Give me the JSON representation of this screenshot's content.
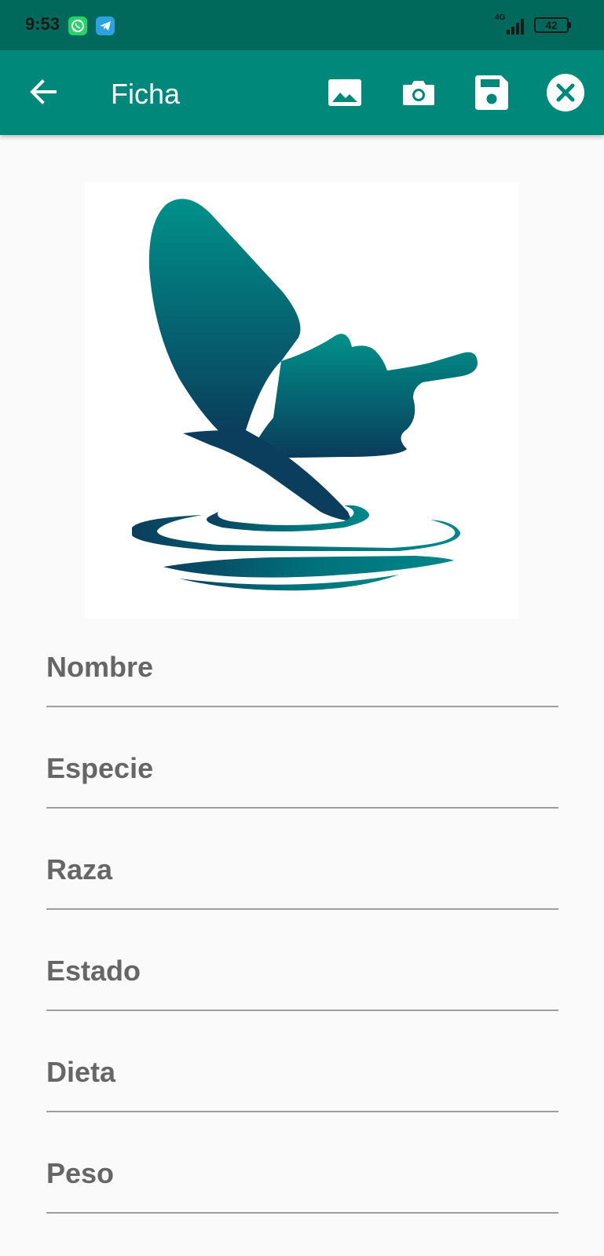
{
  "status_bar": {
    "time": "9:53",
    "network": "4G",
    "battery": "42",
    "icons": [
      "whatsapp-icon",
      "telegram-icon",
      "signal-icon",
      "battery-icon"
    ]
  },
  "app_bar": {
    "title": "Ficha",
    "back_icon": "arrow-back-icon",
    "actions": [
      "image-gallery-icon",
      "camera-icon",
      "save-icon",
      "close-icon"
    ],
    "color": "#00897b",
    "status_color": "#00695c"
  },
  "photo": {
    "icon": "butterfly-logo"
  },
  "form": {
    "fields": [
      {
        "label": "Nombre"
      },
      {
        "label": "Especie"
      },
      {
        "label": "Raza"
      },
      {
        "label": "Estado"
      },
      {
        "label": "Dieta"
      },
      {
        "label": "Peso"
      }
    ]
  }
}
